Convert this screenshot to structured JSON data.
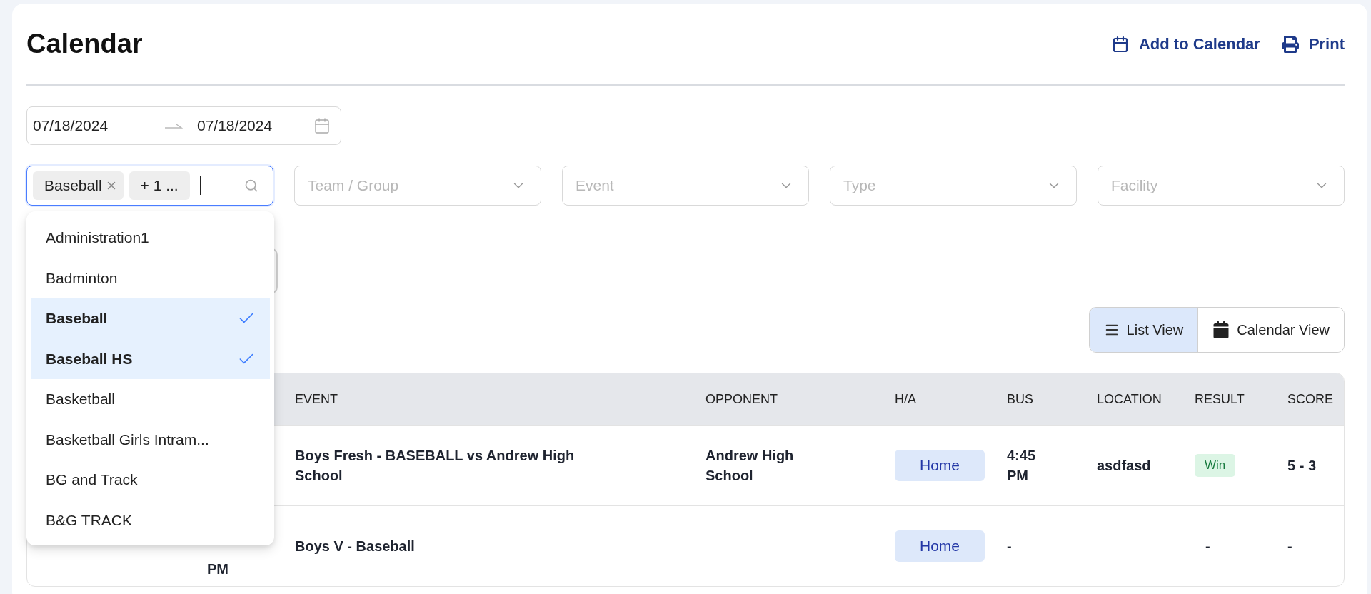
{
  "page": {
    "title": "Calendar"
  },
  "actions": [
    {
      "label": "Add to Calendar",
      "kind": "calendar"
    },
    {
      "label": "Print",
      "kind": "print"
    }
  ],
  "date_range": {
    "start": "07/18/2024",
    "end": "07/18/2024"
  },
  "filters": [
    {
      "kind": "multi",
      "tags": [
        "Baseball"
      ],
      "more": "+ 1 ...",
      "focused": true
    },
    {
      "kind": "select",
      "placeholder": "Team / Group"
    },
    {
      "kind": "select",
      "placeholder": "Event"
    },
    {
      "kind": "select",
      "placeholder": "Type"
    },
    {
      "kind": "select",
      "placeholder": "Facility"
    }
  ],
  "dropdown": {
    "options": [
      {
        "label": "Administration1",
        "selected": false
      },
      {
        "label": "Badminton",
        "selected": false
      },
      {
        "label": "Baseball",
        "selected": true
      },
      {
        "label": "Baseball HS",
        "selected": true
      },
      {
        "label": "Basketball",
        "selected": false
      },
      {
        "label": "Basketball Girls Intram...",
        "selected": false
      },
      {
        "label": "BG and Track",
        "selected": false
      },
      {
        "label": "B&G TRACK",
        "selected": false
      }
    ]
  },
  "view_toggle": [
    {
      "label": "List View",
      "kind": "list",
      "selected": true
    },
    {
      "label": "Calendar View",
      "kind": "calendar",
      "selected": false
    }
  ],
  "table": {
    "columns": [
      "EVENT",
      "OPPONENT",
      "H/A",
      "BUS",
      "LOCATION",
      "RESULT",
      "SCORE"
    ],
    "rows": [
      {
        "event": "Boys Fresh - BASEBALL vs Andrew High School",
        "opponent": "Andrew High School",
        "home_away": "Home",
        "bus": "4:45 PM",
        "location": "asdfasd",
        "result": "Win",
        "result_badge": true,
        "score": "5 - 3"
      },
      {
        "time": "PM",
        "event": "Boys V - Baseball",
        "home_away": "Home",
        "bus": "-",
        "result": "-",
        "result_badge": false,
        "score": "-"
      }
    ]
  }
}
